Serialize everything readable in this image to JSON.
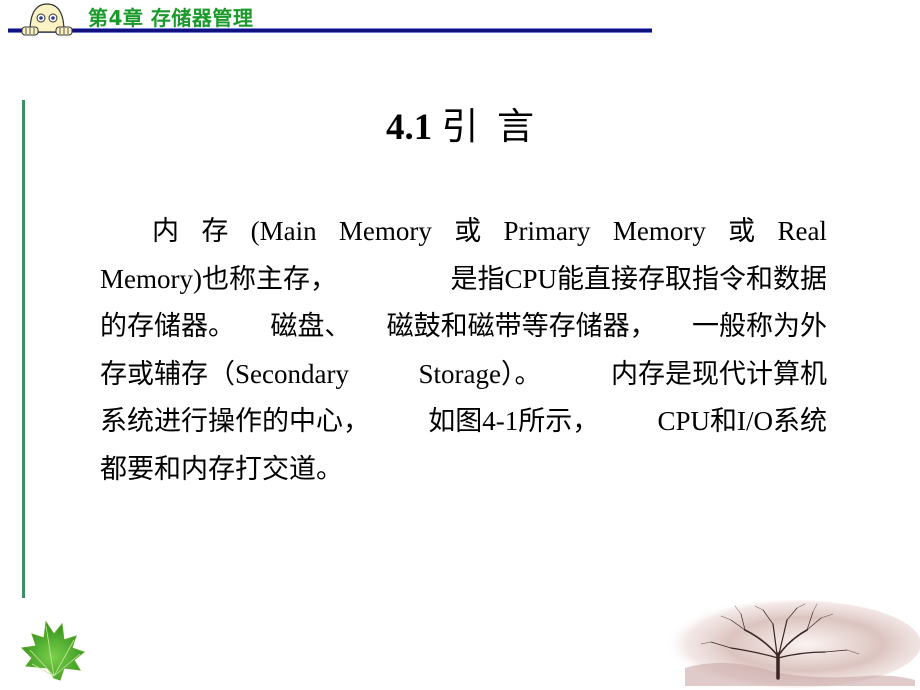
{
  "header": {
    "chapter_title": "第4章 存储器管理",
    "mascot_icon": "peeking-face-icon"
  },
  "section": {
    "number": "4.1",
    "title": " 引  言"
  },
  "paragraph": {
    "lines": [
      [
        "内",
        "存",
        "(Main",
        "Memory",
        "或",
        "Primary",
        "Memory",
        "或",
        "Real"
      ],
      [
        "Memory)也称主存，",
        "是指CPU能直接存取指令和数据"
      ],
      [
        "的存储器。",
        "磁盘、",
        "磁鼓和磁带等存储器，",
        "一般称为外"
      ],
      [
        "存或辅存（Secondary",
        "Storage）。",
        "内存是现代计算机"
      ],
      [
        "系统进行操作的中心，",
        "如图4-1所示，",
        "CPU和I/O系统"
      ],
      [
        "都要和内存打交道。"
      ]
    ]
  },
  "decorations": {
    "leaf_icon": "green-leaf-icon",
    "tree_image": "bare-tree-landscape"
  },
  "colors": {
    "chapter_title": "#1a9a2a",
    "header_rule": "#101080",
    "left_rule": "#3d8f66"
  }
}
